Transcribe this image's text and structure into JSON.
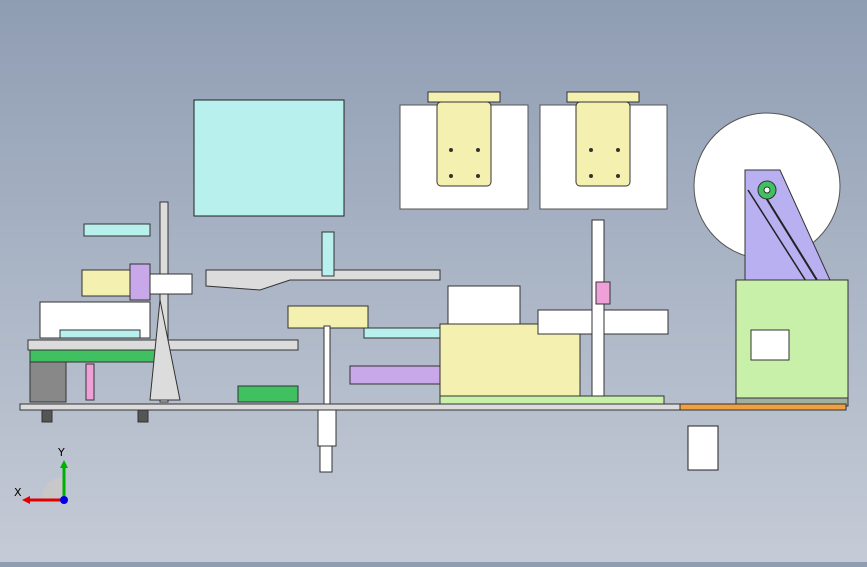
{
  "window": {
    "title": ""
  },
  "triad": {
    "x_label": "X",
    "y_label": "Y"
  },
  "colors": {
    "background_top": "#8f9db3",
    "background_bottom": "#c5cbd6",
    "frame_grey": "#dcdcdc",
    "part_cyan": "#b8f0ee",
    "part_yellow": "#f4f0b0",
    "part_green": "#c8f0a8",
    "part_purple": "#c8a8e8",
    "part_pink": "#f0a0d8",
    "part_lavender": "#b8b0f0",
    "base_orange": "#f0a040",
    "axis_x": "#e00000",
    "axis_y": "#00b000",
    "axis_z": "#0000e0"
  },
  "icons": [
    "coordinate-triad-icon"
  ]
}
